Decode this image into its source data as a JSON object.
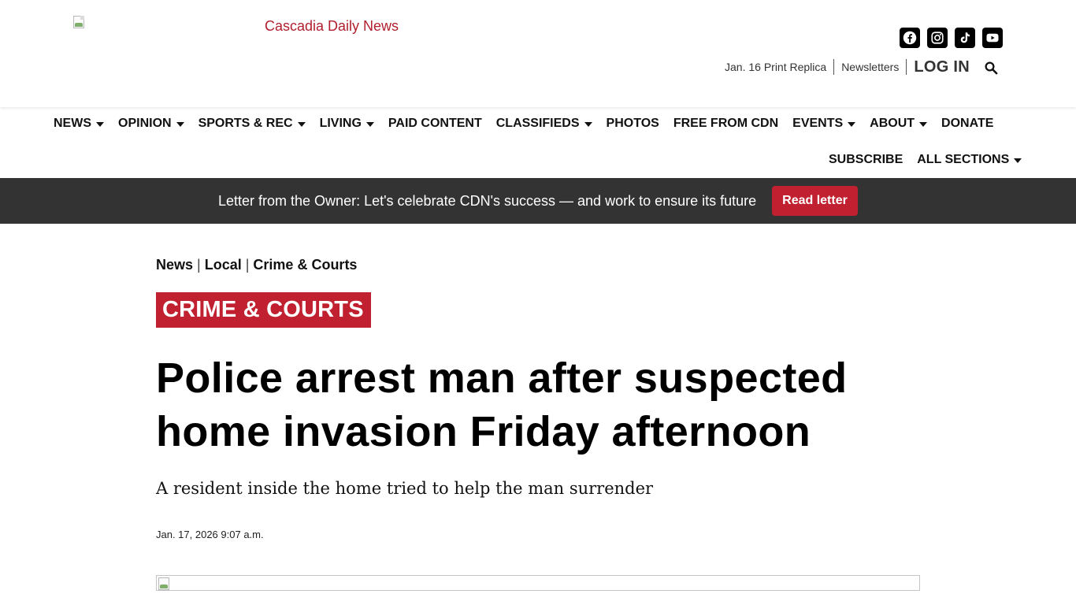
{
  "header": {
    "logo_alt": "Cascadia Daily News",
    "social": [
      "facebook-icon",
      "instagram-icon",
      "tiktok-icon",
      "youtube-icon"
    ],
    "util_links": {
      "print_replica": "Jan. 16 Print Replica",
      "newsletters": "Newsletters",
      "login": "LOG IN"
    }
  },
  "nav": {
    "row1": [
      {
        "label": "NEWS",
        "dropdown": true
      },
      {
        "label": "OPINION",
        "dropdown": true
      },
      {
        "label": "SPORTS & REC",
        "dropdown": true
      },
      {
        "label": "LIVING",
        "dropdown": true
      },
      {
        "label": "PAID CONTENT",
        "dropdown": false
      },
      {
        "label": "CLASSIFIEDS",
        "dropdown": true
      },
      {
        "label": "PHOTOS",
        "dropdown": false
      },
      {
        "label": "FREE FROM CDN",
        "dropdown": false
      },
      {
        "label": "EVENTS",
        "dropdown": true
      },
      {
        "label": "ABOUT",
        "dropdown": true
      },
      {
        "label": "DONATE",
        "dropdown": false
      }
    ],
    "row2": [
      {
        "label": "SUBSCRIBE",
        "dropdown": false
      },
      {
        "label": "ALL SECTIONS",
        "dropdown": true
      }
    ]
  },
  "banner": {
    "text": "Letter from the Owner: Let's celebrate CDN's success — and work to ensure its future",
    "button": "Read letter"
  },
  "article": {
    "breadcrumb": [
      "News",
      "Local",
      "Crime & Courts"
    ],
    "breadcrumb_sep": "|",
    "section": "CRIME & COURTS",
    "headline": "Police arrest man after suspected home invasion Friday afternoon",
    "subhead": "A resident inside the home tried to help the man surrender",
    "date": "Jan. 17, 2026 9:07 a.m."
  },
  "colors": {
    "brand_red": "#c0202f",
    "banner_bg": "#333333"
  }
}
